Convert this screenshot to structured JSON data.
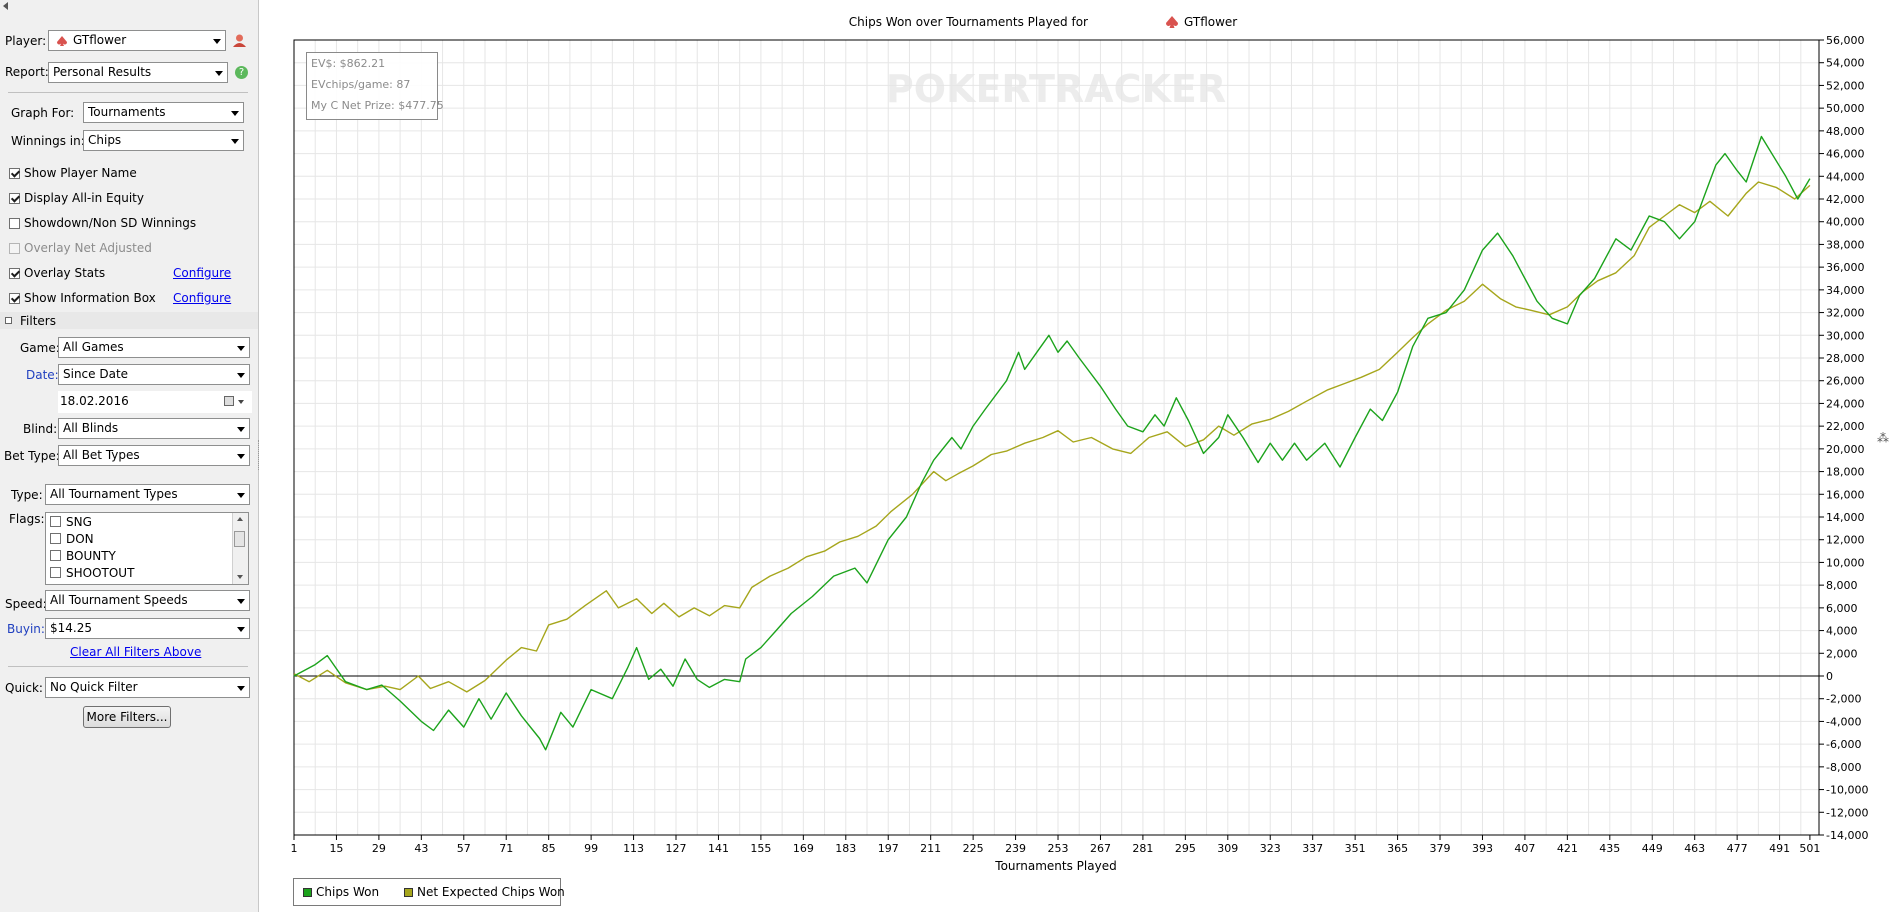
{
  "sidebar": {
    "player_label": "Player:",
    "player_value": "GTflower",
    "report_label": "Report:",
    "report_value": "Personal Results",
    "graph_for_label": "Graph For:",
    "graph_for_value": "Tournaments",
    "winnings_label": "Winnings in:",
    "winnings_value": "Chips",
    "options": [
      {
        "label": "Show Player Name",
        "checked": true,
        "disabled": false
      },
      {
        "label": "Display All-in Equity",
        "checked": true,
        "disabled": false
      },
      {
        "label": "Showdown/Non SD Winnings",
        "checked": false,
        "disabled": false
      },
      {
        "label": "Overlay Net Adjusted",
        "checked": false,
        "disabled": true
      },
      {
        "label": "Overlay Stats",
        "checked": true,
        "disabled": false
      },
      {
        "label": "Show Information Box",
        "checked": true,
        "disabled": false
      }
    ],
    "configure_label": "Configure",
    "filters_heading": "Filters",
    "game_label": "Game:",
    "game_value": "All Games",
    "date_label": "Date:",
    "date_value": "Since Date",
    "date_input": "18.02.2016",
    "blind_label": "Blind:",
    "blind_value": "All Blinds",
    "bet_type_label": "Bet Type:",
    "bet_type_value": "All Bet Types",
    "type_label": "Type:",
    "type_value": "All Tournament Types",
    "flags_label": "Flags:",
    "flags": [
      "SNG",
      "DON",
      "BOUNTY",
      "SHOOTOUT"
    ],
    "speed_label": "Speed:",
    "speed_value": "All Tournament Speeds",
    "buyin_label": "Buyin:",
    "buyin_value": "$14.25",
    "clear_filters": "Clear All Filters Above",
    "quick_label": "Quick:",
    "quick_value": "No Quick Filter",
    "more_filters": "More Filters..."
  },
  "info_box": {
    "ev": "EV$: $862.21",
    "evchips": "EVchips/game: 87",
    "net_prize": "My C Net Prize: $477.75"
  },
  "watermark": "POKERTRACKER",
  "colors": {
    "chips_won": "#1ca31c",
    "net_expected": "#a6a61c",
    "grid": "#e6e6e6",
    "zero_line": "#000000"
  },
  "chart_data": {
    "type": "line",
    "title_prefix": "Chips Won over Tournaments Played for",
    "title_player": "GTflower",
    "xlabel": "Tournaments Played",
    "ylabel": "",
    "xlim": [
      1,
      504
    ],
    "ylim": [
      -14000,
      56000
    ],
    "x_ticks": [
      1,
      15,
      29,
      43,
      57,
      71,
      85,
      99,
      113,
      127,
      141,
      155,
      169,
      183,
      197,
      211,
      225,
      239,
      253,
      267,
      281,
      295,
      309,
      323,
      337,
      351,
      365,
      379,
      393,
      407,
      421,
      435,
      449,
      463,
      477,
      491,
      501
    ],
    "y_ticks": [
      {
        "v": 56000,
        "t": "56,000"
      },
      {
        "v": 54000,
        "t": "54,000"
      },
      {
        "v": 52000,
        "t": "52,000"
      },
      {
        "v": 50000,
        "t": "50,000"
      },
      {
        "v": 48000,
        "t": "48,000"
      },
      {
        "v": 46000,
        "t": "46,000"
      },
      {
        "v": 44000,
        "t": "44,000"
      },
      {
        "v": 42000,
        "t": "42,000"
      },
      {
        "v": 40000,
        "t": "40,000"
      },
      {
        "v": 38000,
        "t": "38,000"
      },
      {
        "v": 36000,
        "t": "36,000"
      },
      {
        "v": 34000,
        "t": "34,000"
      },
      {
        "v": 32000,
        "t": "32,000"
      },
      {
        "v": 30000,
        "t": "30,000"
      },
      {
        "v": 28000,
        "t": "28,000"
      },
      {
        "v": 26000,
        "t": "26,000"
      },
      {
        "v": 24000,
        "t": "24,000"
      },
      {
        "v": 22000,
        "t": "22,000"
      },
      {
        "v": 20000,
        "t": "20,000"
      },
      {
        "v": 18000,
        "t": "18,000"
      },
      {
        "v": 16000,
        "t": "16,000"
      },
      {
        "v": 14000,
        "t": "14,000"
      },
      {
        "v": 12000,
        "t": "12,000"
      },
      {
        "v": 10000,
        "t": "10,000"
      },
      {
        "v": 8000,
        "t": "8,000"
      },
      {
        "v": 6000,
        "t": "6,000"
      },
      {
        "v": 4000,
        "t": "4,000"
      },
      {
        "v": 2000,
        "t": "2,000"
      },
      {
        "v": 0,
        "t": "0"
      },
      {
        "v": -2000,
        "t": "-2,000"
      },
      {
        "v": -4000,
        "t": "-4,000"
      },
      {
        "v": -6000,
        "t": "-6,000"
      },
      {
        "v": -8000,
        "t": "-8,000"
      },
      {
        "v": -10000,
        "t": "-10,000"
      },
      {
        "v": -12000,
        "t": "-12,000"
      },
      {
        "v": -14000,
        "t": "-14,000"
      }
    ],
    "grid": true,
    "legend_position": "bottom-left",
    "series": [
      {
        "name": "Chips Won",
        "points": [
          [
            1,
            0
          ],
          [
            8,
            1000
          ],
          [
            12,
            1800
          ],
          [
            18,
            -500
          ],
          [
            25,
            -1200
          ],
          [
            30,
            -800
          ],
          [
            36,
            -2200
          ],
          [
            43,
            -4000
          ],
          [
            47,
            -4800
          ],
          [
            52,
            -3000
          ],
          [
            57,
            -4500
          ],
          [
            62,
            -2000
          ],
          [
            66,
            -3800
          ],
          [
            71,
            -1500
          ],
          [
            76,
            -3500
          ],
          [
            82,
            -5500
          ],
          [
            84,
            -6500
          ],
          [
            89,
            -3200
          ],
          [
            93,
            -4500
          ],
          [
            99,
            -1200
          ],
          [
            106,
            -2000
          ],
          [
            111,
            700
          ],
          [
            114,
            2500
          ],
          [
            118,
            -300
          ],
          [
            122,
            600
          ],
          [
            126,
            -900
          ],
          [
            130,
            1500
          ],
          [
            134,
            -300
          ],
          [
            138,
            -1000
          ],
          [
            143,
            -300
          ],
          [
            148,
            -500
          ],
          [
            150,
            1500
          ],
          [
            155,
            2500
          ],
          [
            160,
            4000
          ],
          [
            165,
            5500
          ],
          [
            172,
            7000
          ],
          [
            179,
            8800
          ],
          [
            186,
            9500
          ],
          [
            190,
            8200
          ],
          [
            197,
            12000
          ],
          [
            203,
            14000
          ],
          [
            208,
            17000
          ],
          [
            212,
            19000
          ],
          [
            218,
            21000
          ],
          [
            221,
            20000
          ],
          [
            225,
            22000
          ],
          [
            229,
            23500
          ],
          [
            236,
            26000
          ],
          [
            240,
            28500
          ],
          [
            242,
            27000
          ],
          [
            246,
            28500
          ],
          [
            250,
            30000
          ],
          [
            253,
            28500
          ],
          [
            256,
            29500
          ],
          [
            260,
            28000
          ],
          [
            267,
            25500
          ],
          [
            272,
            23500
          ],
          [
            276,
            22000
          ],
          [
            281,
            21500
          ],
          [
            285,
            23000
          ],
          [
            288,
            22000
          ],
          [
            292,
            24500
          ],
          [
            296,
            22500
          ],
          [
            301,
            19600
          ],
          [
            306,
            21000
          ],
          [
            309,
            23000
          ],
          [
            314,
            21000
          ],
          [
            319,
            18800
          ],
          [
            323,
            20500
          ],
          [
            327,
            19000
          ],
          [
            331,
            20500
          ],
          [
            335,
            19000
          ],
          [
            341,
            20500
          ],
          [
            346,
            18400
          ],
          [
            351,
            21000
          ],
          [
            356,
            23500
          ],
          [
            360,
            22500
          ],
          [
            365,
            25000
          ],
          [
            370,
            29000
          ],
          [
            375,
            31500
          ],
          [
            381,
            32000
          ],
          [
            387,
            34000
          ],
          [
            393,
            37500
          ],
          [
            398,
            39000
          ],
          [
            403,
            37000
          ],
          [
            407,
            35000
          ],
          [
            411,
            33000
          ],
          [
            416,
            31500
          ],
          [
            421,
            31000
          ],
          [
            425,
            33500
          ],
          [
            430,
            35000
          ],
          [
            437,
            38500
          ],
          [
            442,
            37500
          ],
          [
            448,
            40500
          ],
          [
            453,
            40000
          ],
          [
            458,
            38500
          ],
          [
            463,
            40000
          ],
          [
            470,
            45000
          ],
          [
            473,
            46000
          ],
          [
            477,
            44500
          ],
          [
            480,
            43500
          ],
          [
            485,
            47500
          ],
          [
            493,
            44000
          ],
          [
            497,
            42000
          ],
          [
            501,
            43800
          ]
        ]
      },
      {
        "name": "Net Expected Chips Won",
        "points": [
          [
            1,
            200
          ],
          [
            6,
            -500
          ],
          [
            12,
            500
          ],
          [
            18,
            -600
          ],
          [
            25,
            -1200
          ],
          [
            31,
            -900
          ],
          [
            36,
            -1200
          ],
          [
            42,
            0
          ],
          [
            46,
            -1100
          ],
          [
            52,
            -500
          ],
          [
            58,
            -1400
          ],
          [
            64,
            -400
          ],
          [
            71,
            1400
          ],
          [
            76,
            2500
          ],
          [
            81,
            2200
          ],
          [
            85,
            4500
          ],
          [
            91,
            5000
          ],
          [
            97,
            6200
          ],
          [
            104,
            7500
          ],
          [
            108,
            6000
          ],
          [
            114,
            6800
          ],
          [
            119,
            5500
          ],
          [
            123,
            6400
          ],
          [
            128,
            5200
          ],
          [
            133,
            6000
          ],
          [
            138,
            5300
          ],
          [
            143,
            6200
          ],
          [
            148,
            6000
          ],
          [
            152,
            7800
          ],
          [
            158,
            8800
          ],
          [
            164,
            9500
          ],
          [
            170,
            10500
          ],
          [
            176,
            11000
          ],
          [
            181,
            11800
          ],
          [
            187,
            12300
          ],
          [
            193,
            13200
          ],
          [
            198,
            14500
          ],
          [
            205,
            16000
          ],
          [
            212,
            18000
          ],
          [
            216,
            17200
          ],
          [
            220,
            17800
          ],
          [
            225,
            18500
          ],
          [
            231,
            19500
          ],
          [
            236,
            19800
          ],
          [
            242,
            20500
          ],
          [
            248,
            21000
          ],
          [
            253,
            21600
          ],
          [
            258,
            20600
          ],
          [
            264,
            21000
          ],
          [
            271,
            20000
          ],
          [
            277,
            19600
          ],
          [
            283,
            21000
          ],
          [
            289,
            21500
          ],
          [
            295,
            20200
          ],
          [
            301,
            20800
          ],
          [
            306,
            22000
          ],
          [
            311,
            21200
          ],
          [
            317,
            22200
          ],
          [
            323,
            22600
          ],
          [
            329,
            23300
          ],
          [
            335,
            24200
          ],
          [
            342,
            25200
          ],
          [
            348,
            25800
          ],
          [
            353,
            26300
          ],
          [
            359,
            27000
          ],
          [
            365,
            28500
          ],
          [
            370,
            29800
          ],
          [
            375,
            31000
          ],
          [
            381,
            32200
          ],
          [
            387,
            33000
          ],
          [
            393,
            34500
          ],
          [
            399,
            33200
          ],
          [
            404,
            32500
          ],
          [
            409,
            32200
          ],
          [
            415,
            31800
          ],
          [
            421,
            32500
          ],
          [
            426,
            33800
          ],
          [
            431,
            34800
          ],
          [
            437,
            35500
          ],
          [
            443,
            37000
          ],
          [
            448,
            39500
          ],
          [
            453,
            40500
          ],
          [
            458,
            41500
          ],
          [
            463,
            40800
          ],
          [
            468,
            41800
          ],
          [
            474,
            40500
          ],
          [
            480,
            42500
          ],
          [
            484,
            43500
          ],
          [
            490,
            43000
          ],
          [
            496,
            42000
          ],
          [
            501,
            43200
          ]
        ]
      }
    ]
  }
}
